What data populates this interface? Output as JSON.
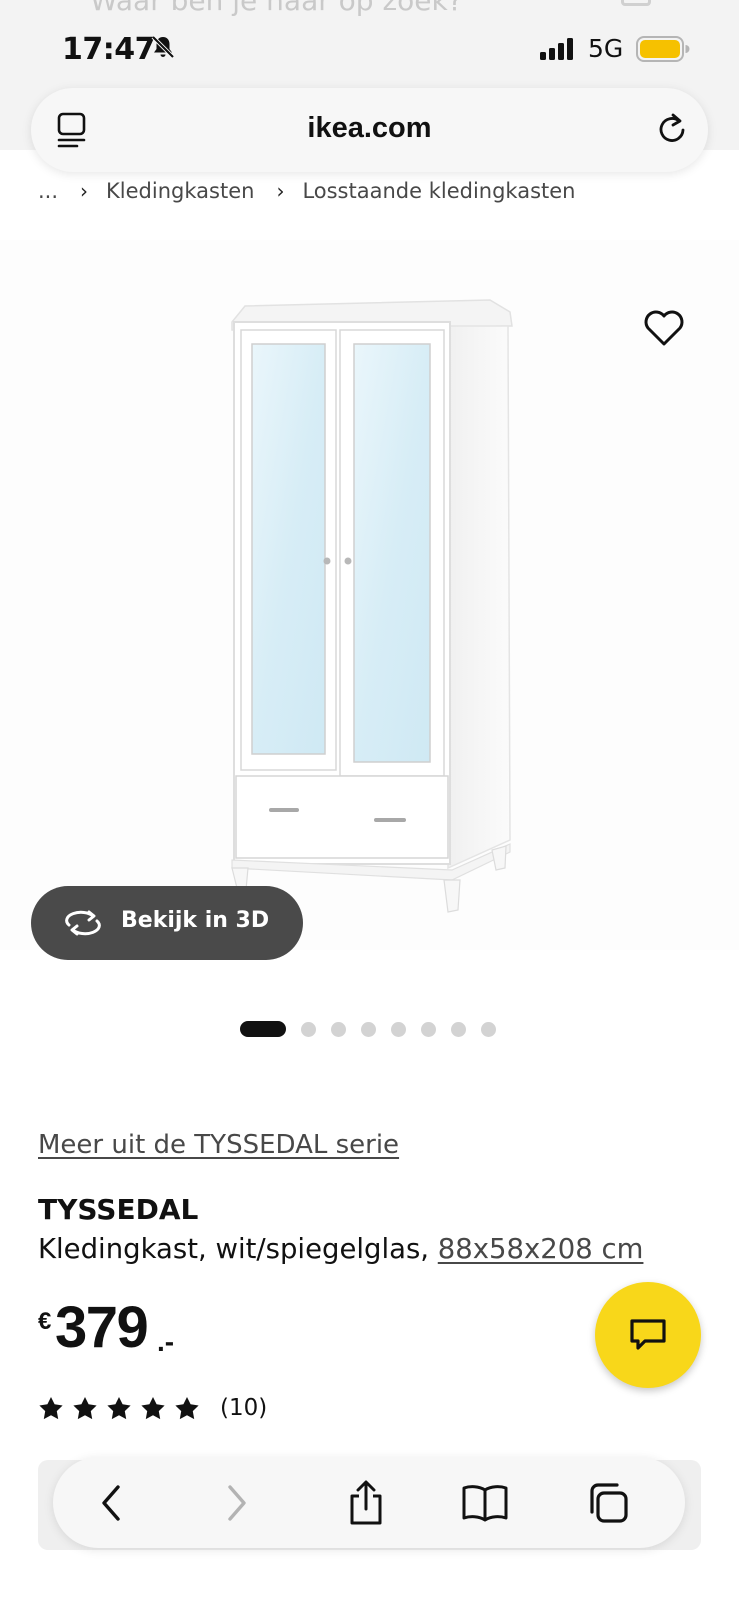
{
  "status_bar": {
    "time": "17:47",
    "network": "5G",
    "icons": [
      "bell-slash-icon",
      "signal-icon",
      "battery-icon"
    ],
    "battery_color": "#f6c100"
  },
  "ghost_search": {
    "placeholder": "Waar ben je naar op zoek?"
  },
  "browser": {
    "url": "ikea.com",
    "toolbar": [
      "back-icon",
      "forward-icon",
      "share-icon",
      "bookmarks-icon",
      "tabs-icon"
    ]
  },
  "breadcrumb": {
    "items": [
      "...",
      "Kledingkasten",
      "Losstaande kledingkasten"
    ]
  },
  "gallery": {
    "view_3d_label": "Bekijk in 3D",
    "image_count": 8,
    "active_index": 0
  },
  "product": {
    "series_link": "Meer uit de TYSSEDAL serie",
    "name": "TYSSEDAL",
    "description": "Kledingkast, wit/spiegelglas, ",
    "dimensions": "88x58x208 cm",
    "price_currency": "€",
    "price_amount": "379",
    "price_suffix": ".-",
    "rating_stars": 5,
    "rating_count": "(10)"
  },
  "colors": {
    "chat_button": "#f8d71a",
    "view_3d_button": "#4a4a4a",
    "text": "#111111"
  }
}
